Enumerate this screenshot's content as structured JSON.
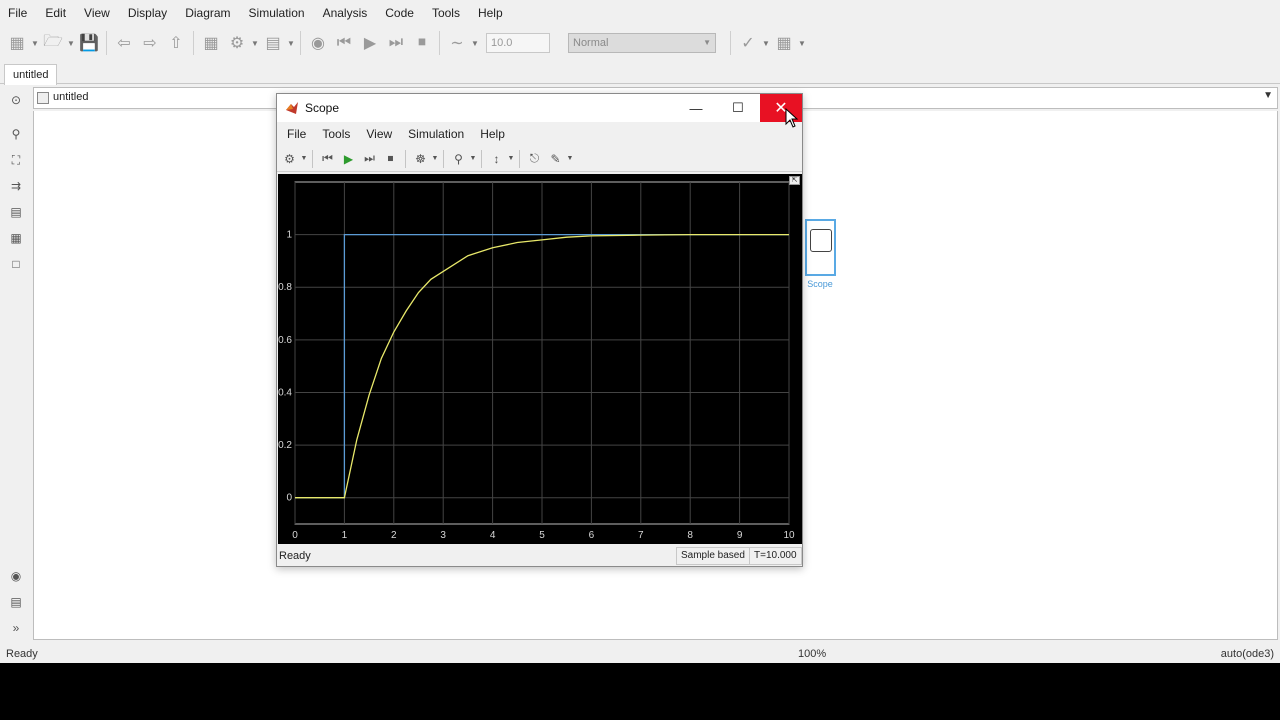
{
  "menubar": {
    "items": [
      "File",
      "Edit",
      "View",
      "Display",
      "Diagram",
      "Simulation",
      "Analysis",
      "Code",
      "Tools",
      "Help"
    ]
  },
  "toolbar": {
    "stop_time": "10.0",
    "sim_mode": "Normal"
  },
  "tabs": {
    "model_tab": "untitled"
  },
  "addressbar": {
    "path": "untitled"
  },
  "canvas": {
    "scope_block_label": "Scope"
  },
  "statusbar": {
    "ready": "Ready",
    "zoom": "100%",
    "solver": "auto(ode3)"
  },
  "scope_window": {
    "title": "Scope",
    "menu": [
      "File",
      "Tools",
      "View",
      "Simulation",
      "Help"
    ],
    "status": {
      "ready": "Ready",
      "mode": "Sample based",
      "time": "T=10.000"
    }
  },
  "chart_data": {
    "type": "line",
    "title": "",
    "xlabel": "",
    "ylabel": "",
    "xlim": [
      0,
      10
    ],
    "ylim": [
      -0.1,
      1.2
    ],
    "x_ticks": [
      0,
      1,
      2,
      3,
      4,
      5,
      6,
      7,
      8,
      9,
      10
    ],
    "y_ticks": [
      0,
      0.2,
      0.4,
      0.6,
      0.8,
      1
    ],
    "y_tick_labels": [
      "0",
      "0.2",
      "0.4",
      "0.6",
      "0.8",
      "1"
    ],
    "grid": true,
    "background": "#000000",
    "series": [
      {
        "color": "#5b9bd5",
        "x": [
          0,
          1,
          1,
          10
        ],
        "y": [
          0,
          0,
          1,
          1
        ]
      },
      {
        "color": "#e8e86a",
        "x": [
          0,
          1,
          1.25,
          1.5,
          1.75,
          2,
          2.25,
          2.5,
          2.75,
          3,
          3.5,
          4,
          4.5,
          5,
          5.5,
          6,
          7,
          8,
          9,
          10
        ],
        "y": [
          0,
          0,
          0.22,
          0.39,
          0.53,
          0.63,
          0.71,
          0.78,
          0.83,
          0.86,
          0.92,
          0.95,
          0.97,
          0.98,
          0.99,
          0.995,
          0.998,
          1.0,
          1.0,
          1.0
        ]
      }
    ]
  }
}
